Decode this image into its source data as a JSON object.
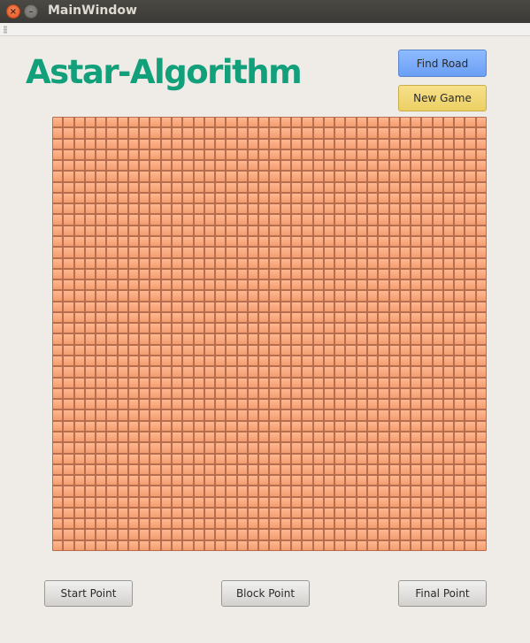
{
  "window": {
    "title": "MainWindow",
    "close_glyph": "×",
    "minimize_glyph": "–",
    "close_icon": "close-icon",
    "minimize_icon": "minimize-icon"
  },
  "app": {
    "title": "Astar-Algorithm",
    "title_color": "#12a07a"
  },
  "buttons": {
    "find_road": "Find Road",
    "new_game": "New Game",
    "start_point": "Start Point",
    "block_point": "Block Point",
    "final_point": "Final Point",
    "find_road_color": "#7aaef9",
    "new_game_color": "#f0d878"
  },
  "grid": {
    "rows": 40,
    "cols": 40,
    "cell_color": "#f9aa80"
  }
}
